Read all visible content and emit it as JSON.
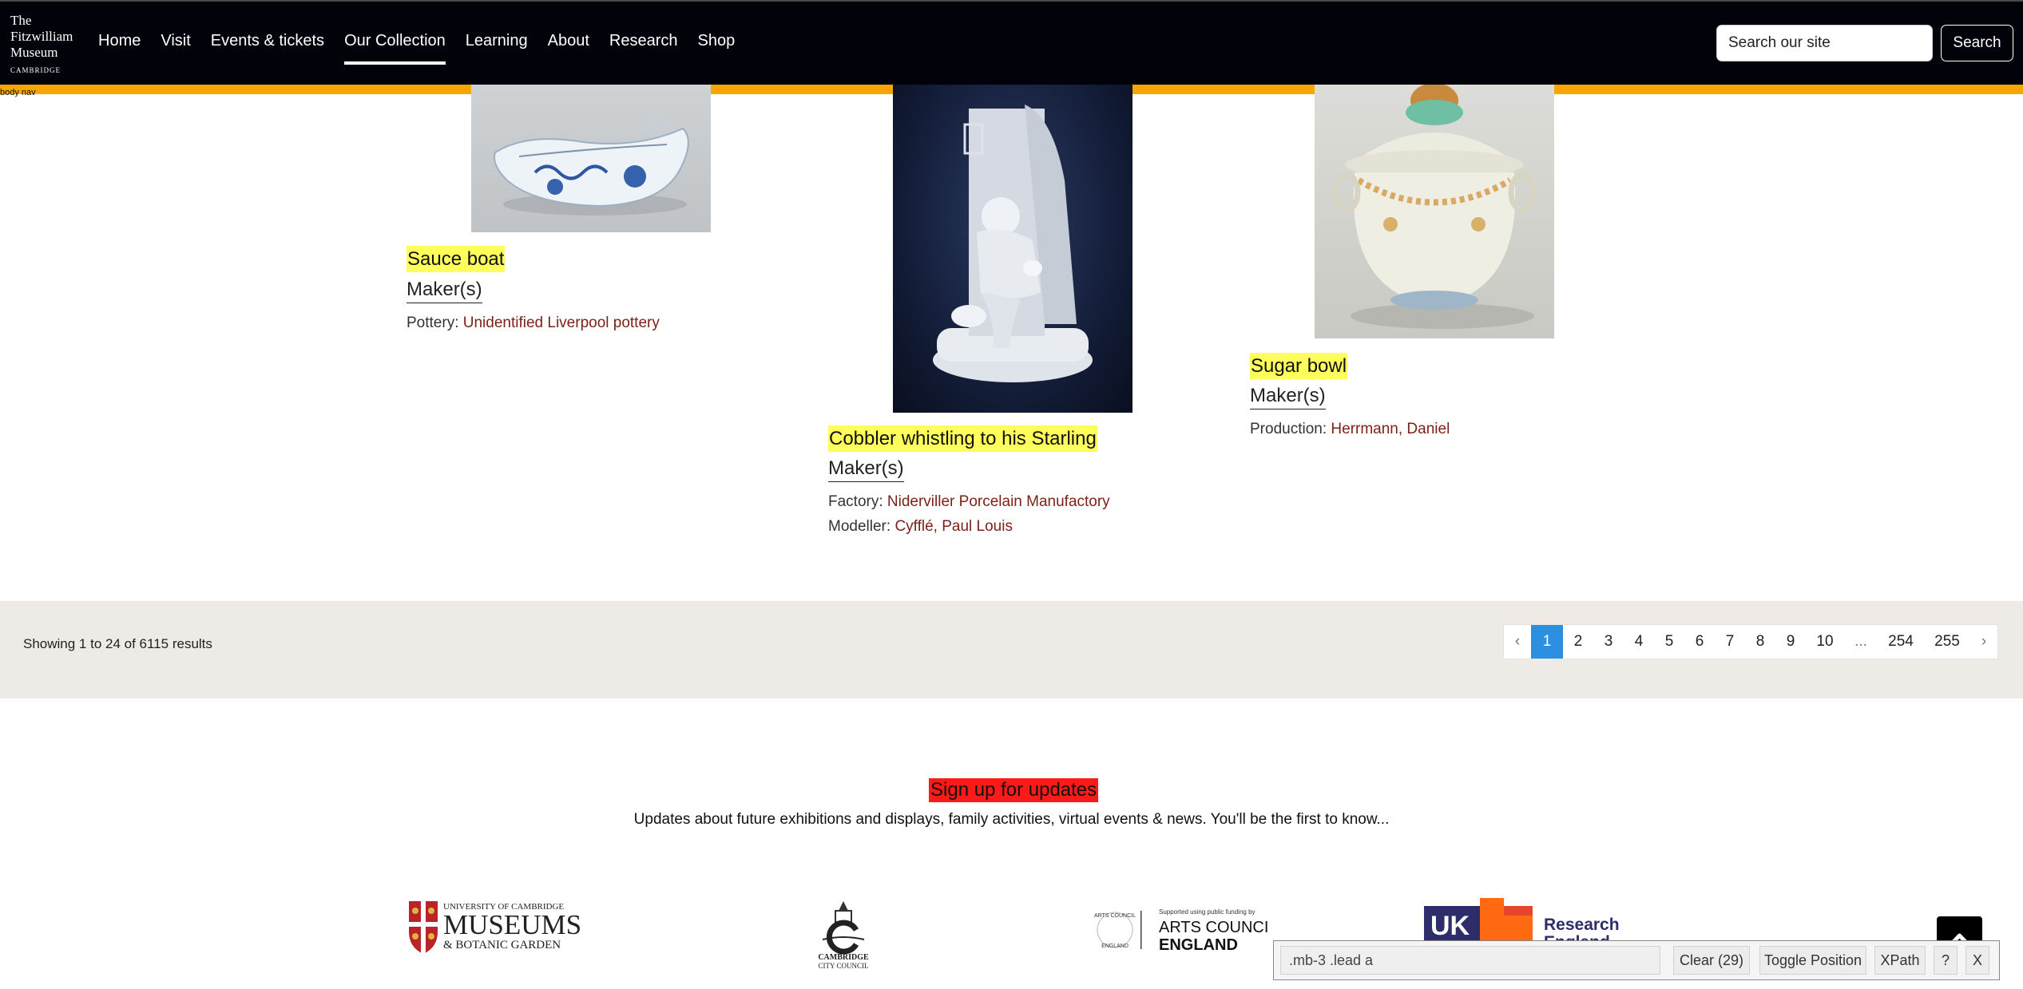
{
  "header": {
    "logo": {
      "line1": "The",
      "line2": "Fitzwilliam",
      "line3": "Museum",
      "line4": "CAMBRIDGE"
    },
    "nav": [
      "Home",
      "Visit",
      "Events & tickets",
      "Our Collection",
      "Learning",
      "About",
      "Research",
      "Shop"
    ],
    "nav_active": "Our Collection",
    "search": {
      "placeholder": "Search our site",
      "button_label": "Search"
    }
  },
  "skip_note": "body nav",
  "colors": {
    "header_bg": "#02020a",
    "accent_bar": "#f7a600",
    "title_highlight": "#ffff5c",
    "link": "#7d2218",
    "pager_active": "#2d8fe0",
    "signup_highlight": "#ff1a1a"
  },
  "cards": [
    {
      "title": "Sauce boat",
      "maker_link": "Maker(s)",
      "meta": [
        {
          "label": "Pottery:",
          "value": "Unidentified Liverpool pottery"
        }
      ]
    },
    {
      "title": "Cobbler whistling to his Starling",
      "maker_link": "Maker(s)",
      "meta": [
        {
          "label": "Factory:",
          "value": "Niderviller Porcelain Manufactory"
        },
        {
          "label": "Modeller:",
          "value": "Cyfflé, Paul Louis"
        }
      ]
    },
    {
      "title": "Sugar bowl",
      "maker_link": "Maker(s)",
      "meta": [
        {
          "label": "Production:",
          "value": "Herrmann, Daniel"
        }
      ]
    }
  ],
  "results": {
    "summary": "Showing 1 to 24 of 6115 results",
    "pages": [
      "‹",
      "1",
      "2",
      "3",
      "4",
      "5",
      "6",
      "7",
      "8",
      "9",
      "10",
      "...",
      "254",
      "255",
      "›"
    ],
    "current_page": "1"
  },
  "signup": {
    "heading": "Sign up for updates",
    "text": "Updates about future exhibitions and displays, family activities, virtual events & news. You'll be the first to know..."
  },
  "partners": {
    "museums": {
      "line1": "UNIVERSITY OF CAMBRIDGE",
      "line2": "MUSEUMS",
      "line3": "& BOTANIC GARDEN"
    },
    "city": {
      "line1": "CAMBRIDGE",
      "line2": "CITY COUNCIL"
    },
    "arts": {
      "small": "Supported using public funding by",
      "line1": "ARTS COUNCIL",
      "line2": "ENGLAND",
      "ring_top": "ARTS COUNCIL",
      "ring_bottom": "ENGLAND"
    },
    "ukri": {
      "mark": "UK",
      "line1": "Research",
      "line2": "England"
    }
  },
  "selector_tool": {
    "query": ".mb-3 .lead a",
    "clear_label": "Clear (29)",
    "toggle_label": "Toggle Position",
    "xpath_label": "XPath",
    "help_label": "?",
    "close_label": "X"
  }
}
